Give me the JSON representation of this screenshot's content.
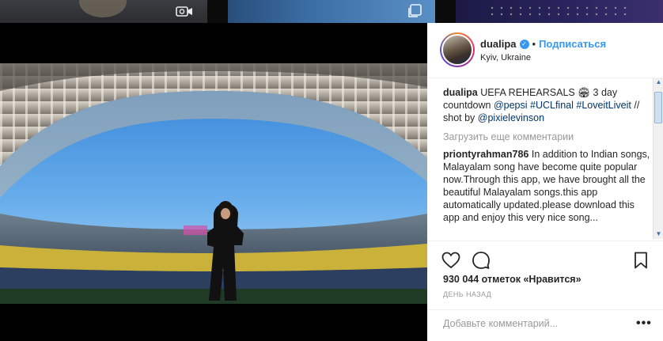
{
  "post": {
    "username": "dualipa",
    "follow_label": "Подписаться",
    "location": "Kyiv, Ukraine",
    "caption_user": "dualipa",
    "caption_text": " UEFA REHEARSALS 🏟 3 day countdown ",
    "caption_links": [
      "@pepsi",
      "#UCLfinal",
      "#LoveitLiveit",
      "@pixielevinson"
    ],
    "caption_mid": " // shot by ",
    "load_more": "Загрузить еще комментарии",
    "comment_user": "priontyrahman786",
    "comment_text": " In addition to Indian songs, Malayalam song have become quite popular now.Through this app, we have brought all the beautiful Malayalam songs.this app automatically updated.please download this app and enjoy this very nice song...",
    "likes": "930 044 отметок «Нравится»",
    "time": "ДЕНЬ НАЗАД",
    "add_comment_placeholder": "Добавьте комментарий...",
    "more_label": "•••"
  },
  "carousel": {
    "count": 3,
    "active_index": 0
  },
  "icons": {
    "thumb_a": "video-camera-icon",
    "thumb_b": "multiple-photos-icon",
    "like": "heart-icon",
    "comment": "comment-bubble-icon",
    "save": "bookmark-icon",
    "verified": "verified-badge-icon"
  },
  "colors": {
    "accent": "#3897f0",
    "link": "#003569",
    "muted": "#999999"
  }
}
